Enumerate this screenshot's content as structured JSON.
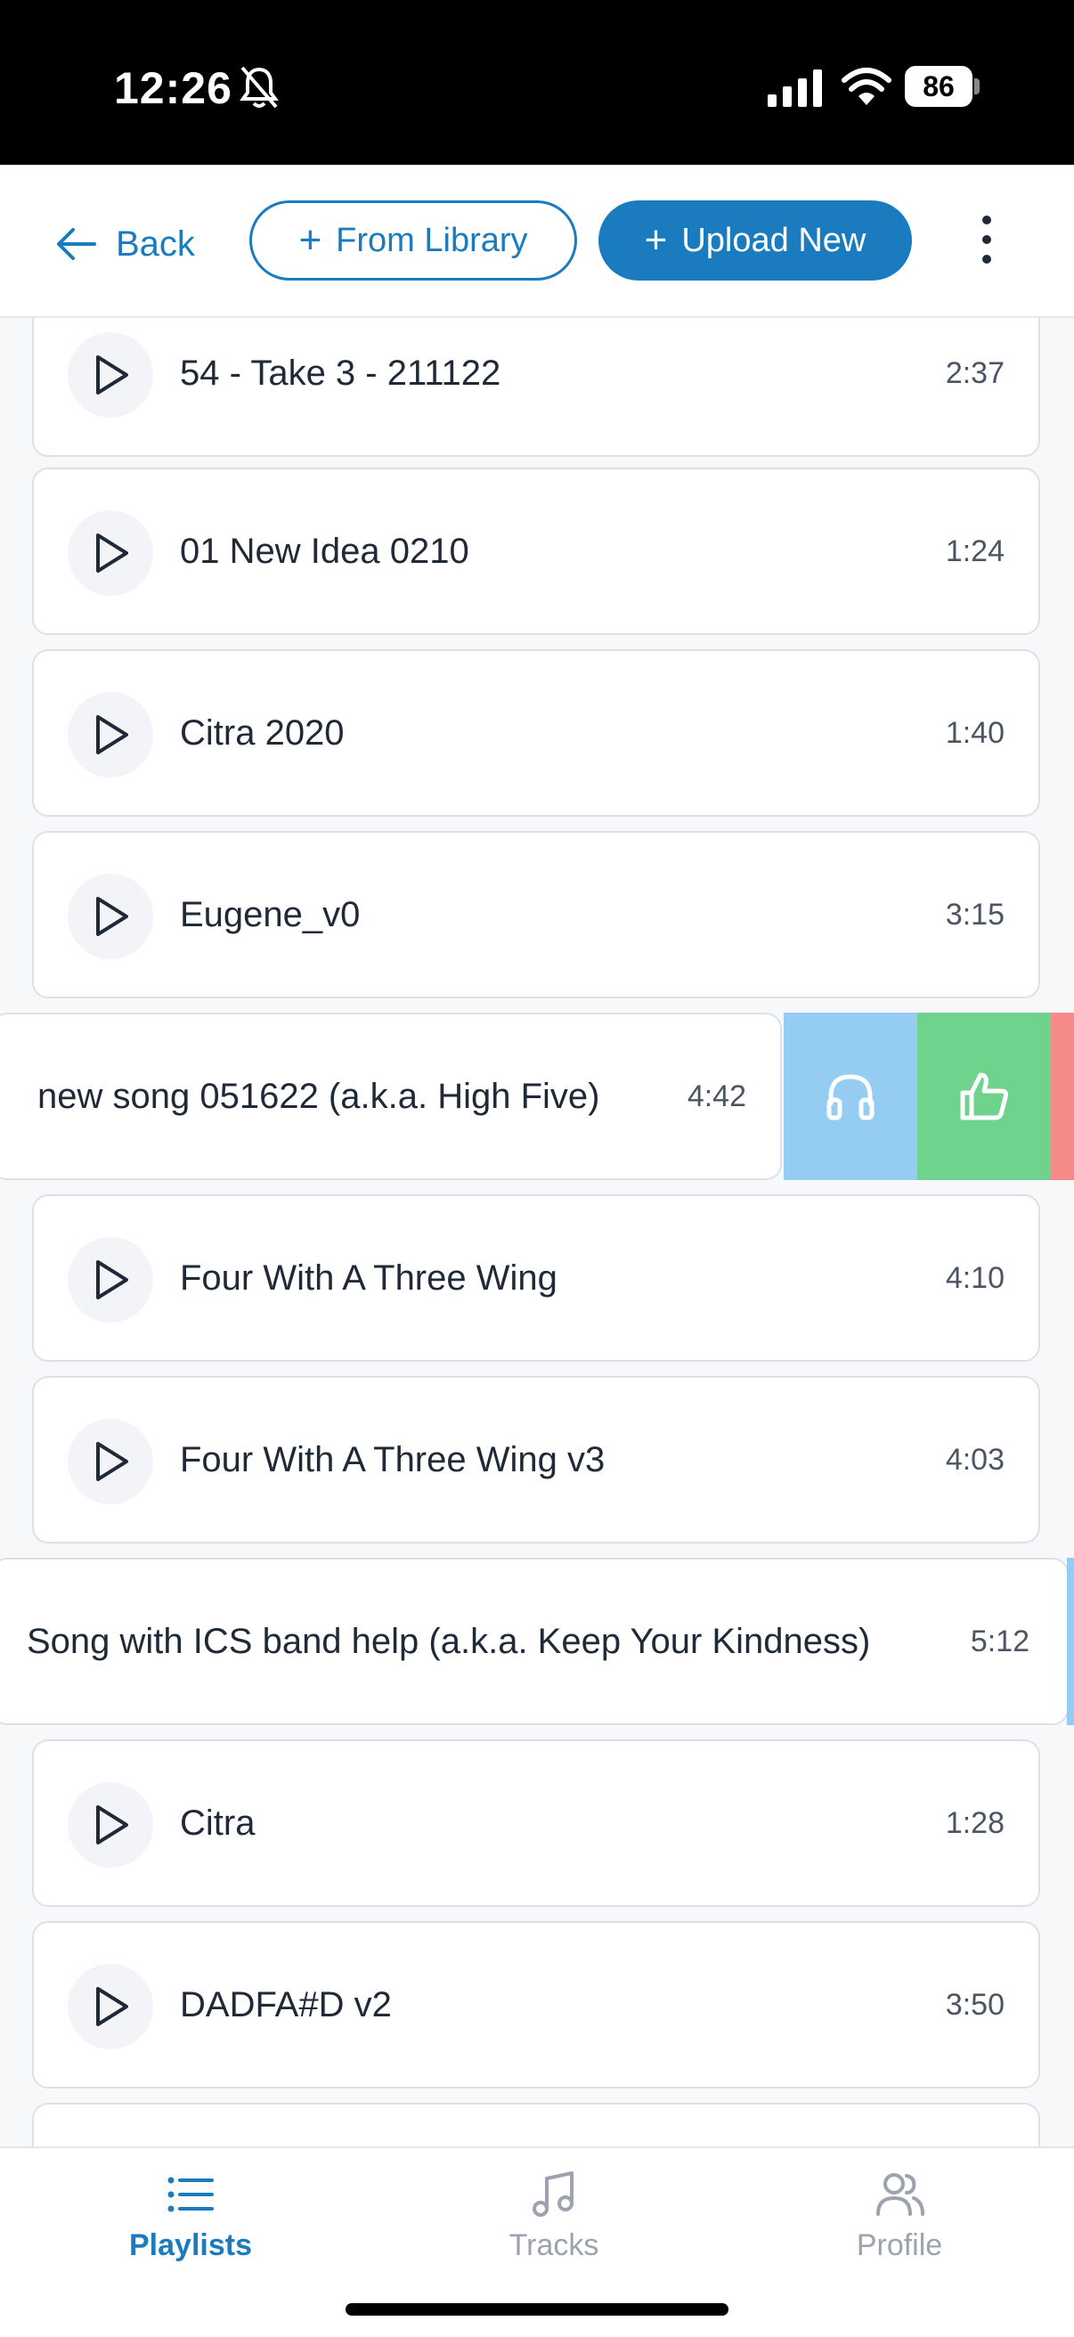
{
  "status_bar": {
    "time": "12:26",
    "battery": "86"
  },
  "header": {
    "back_label": "Back",
    "from_library_label": "From Library",
    "upload_new_label": "Upload New"
  },
  "tracks": [
    {
      "title": "54 - Take 3 - 211122",
      "duration": "2:37"
    },
    {
      "title": "01 New Idea 0210",
      "duration": "1:24"
    },
    {
      "title": "Citra 2020",
      "duration": "1:40"
    },
    {
      "title": "Eugene_v0",
      "duration": "3:15"
    },
    {
      "title": "new song 051622 (a.k.a. High Five)",
      "duration": "4:42"
    },
    {
      "title": "Four With A Three Wing",
      "duration": "4:10"
    },
    {
      "title": "Four With A Three Wing v3",
      "duration": "4:03"
    },
    {
      "title": "Song with ICS band help (a.k.a. Keep Your Kindness)",
      "duration": "5:12"
    },
    {
      "title": "Citra",
      "duration": "1:28"
    },
    {
      "title": "DADFA#D v2",
      "duration": "3:50"
    }
  ],
  "swipe_actions": {
    "listen_icon": "headphones-icon",
    "like_icon": "thumbs-up-icon",
    "colors": {
      "listen": "#95cdf2",
      "like": "#6fd38e",
      "delete": "#f58a88"
    }
  },
  "tab_bar": {
    "tabs": [
      {
        "label": "Playlists",
        "icon": "list-icon",
        "active": true
      },
      {
        "label": "Tracks",
        "icon": "music-note-icon",
        "active": false
      },
      {
        "label": "Profile",
        "icon": "users-icon",
        "active": false
      }
    ]
  },
  "colors": {
    "accent": "#1a7bbf"
  }
}
